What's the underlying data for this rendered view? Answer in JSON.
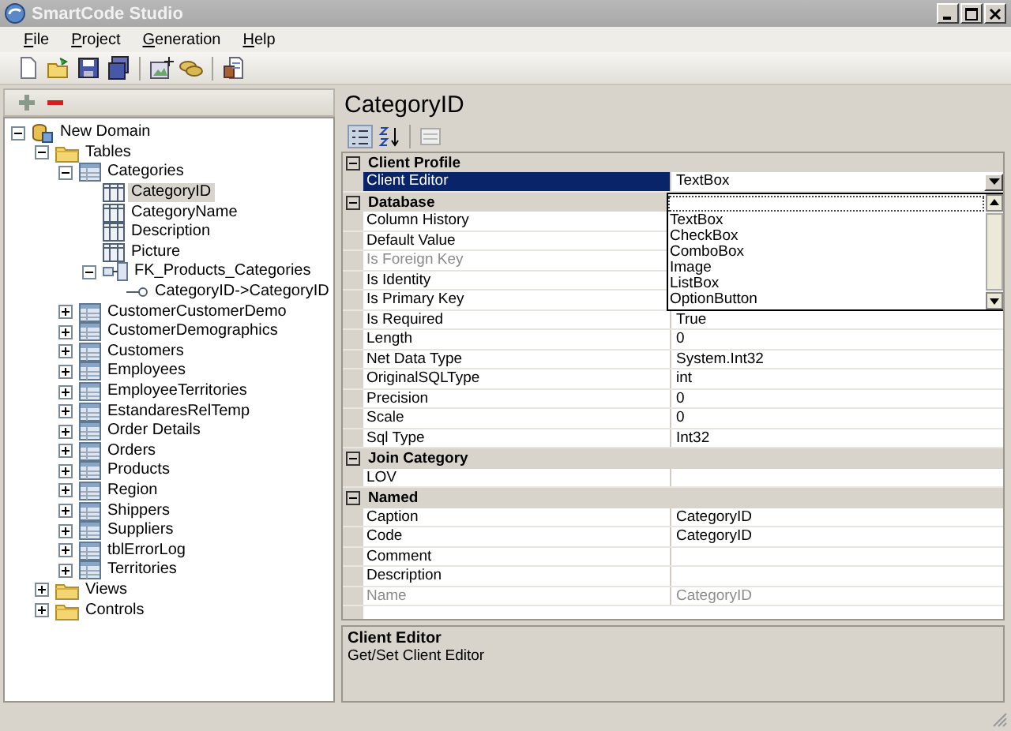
{
  "window": {
    "title": "SmartCode Studio"
  },
  "menu": [
    {
      "label": "File"
    },
    {
      "label": "Project"
    },
    {
      "label": "Generation"
    },
    {
      "label": "Help"
    }
  ],
  "tree": [
    {
      "label": "New Domain",
      "kind": "domain",
      "expanded": true,
      "selected": false,
      "children": [
        {
          "label": "Tables",
          "kind": "folder",
          "expanded": true,
          "selected": false,
          "children": [
            {
              "label": "Categories",
              "kind": "table",
              "expanded": true,
              "selected": false,
              "children": [
                {
                  "label": "CategoryID",
                  "kind": "column",
                  "selected": true
                },
                {
                  "label": "CategoryName",
                  "kind": "column",
                  "selected": false
                },
                {
                  "label": "Description",
                  "kind": "column",
                  "selected": false
                },
                {
                  "label": "Picture",
                  "kind": "column",
                  "selected": false
                },
                {
                  "label": "FK_Products_Categories",
                  "kind": "key",
                  "expanded": true,
                  "selected": false,
                  "children": [
                    {
                      "label": "CategoryID->CategoryID",
                      "kind": "relation",
                      "selected": false
                    }
                  ]
                }
              ]
            },
            {
              "label": "CustomerCustomerDemo",
              "kind": "table",
              "expanded": false,
              "selected": false
            },
            {
              "label": "CustomerDemographics",
              "kind": "table",
              "expanded": false,
              "selected": false
            },
            {
              "label": "Customers",
              "kind": "table",
              "expanded": false,
              "selected": false
            },
            {
              "label": "Employees",
              "kind": "table",
              "expanded": false,
              "selected": false
            },
            {
              "label": "EmployeeTerritories",
              "kind": "table",
              "expanded": false,
              "selected": false
            },
            {
              "label": "EstandaresRelTemp",
              "kind": "table",
              "expanded": false,
              "selected": false
            },
            {
              "label": "Order Details",
              "kind": "table",
              "expanded": false,
              "selected": false
            },
            {
              "label": "Orders",
              "kind": "table",
              "expanded": false,
              "selected": false
            },
            {
              "label": "Products",
              "kind": "table",
              "expanded": false,
              "selected": false
            },
            {
              "label": "Region",
              "kind": "table",
              "expanded": false,
              "selected": false
            },
            {
              "label": "Shippers",
              "kind": "table",
              "expanded": false,
              "selected": false
            },
            {
              "label": "Suppliers",
              "kind": "table",
              "expanded": false,
              "selected": false
            },
            {
              "label": "tblErrorLog",
              "kind": "table",
              "expanded": false,
              "selected": false
            },
            {
              "label": "Territories",
              "kind": "table",
              "expanded": false,
              "selected": false
            }
          ]
        },
        {
          "label": "Views",
          "kind": "folder",
          "expanded": false,
          "selected": false
        },
        {
          "label": "Controls",
          "kind": "folder",
          "expanded": false,
          "selected": false
        }
      ]
    }
  ],
  "properties": {
    "title": "CategoryID",
    "categories": [
      {
        "name": "Client Profile",
        "expanded": true,
        "rows": [
          {
            "name": "Client Editor",
            "value": "TextBox",
            "selected": true,
            "disabled": false
          }
        ]
      },
      {
        "name": "Database",
        "expanded": true,
        "rows": [
          {
            "name": "Column History",
            "selected": false,
            "disabled": false
          },
          {
            "name": "Default Value",
            "selected": false,
            "disabled": false
          },
          {
            "name": "Is Foreign Key",
            "selected": false,
            "disabled": true
          },
          {
            "name": "Is Identity",
            "selected": false,
            "disabled": false
          },
          {
            "name": "Is Primary Key",
            "selected": false,
            "disabled": false
          },
          {
            "name": "Is Required",
            "value": "True",
            "selected": false,
            "disabled": false
          },
          {
            "name": "Length",
            "value": "0",
            "selected": false,
            "disabled": false
          },
          {
            "name": "Net Data Type",
            "value": "System.Int32",
            "selected": false,
            "disabled": false
          },
          {
            "name": "OriginalSQLType",
            "value": "int",
            "selected": false,
            "disabled": false
          },
          {
            "name": "Precision",
            "value": "0",
            "selected": false,
            "disabled": false
          },
          {
            "name": "Scale",
            "value": "0",
            "selected": false,
            "disabled": false
          },
          {
            "name": "Sql Type",
            "value": "Int32",
            "selected": false,
            "disabled": false
          }
        ]
      },
      {
        "name": "Join Category",
        "expanded": true,
        "rows": [
          {
            "name": "LOV",
            "selected": false,
            "disabled": false
          }
        ]
      },
      {
        "name": "Named",
        "expanded": true,
        "rows": [
          {
            "name": "Caption",
            "value": "CategoryID",
            "selected": false,
            "disabled": false
          },
          {
            "name": "Code",
            "value": "CategoryID",
            "selected": false,
            "disabled": false
          },
          {
            "name": "Comment",
            "selected": false,
            "disabled": false
          },
          {
            "name": "Description",
            "selected": false,
            "disabled": false
          },
          {
            "name": "Name",
            "value": "CategoryID",
            "selected": false,
            "disabled": true
          }
        ]
      }
    ]
  },
  "dropdown": {
    "items": [
      "TextBox",
      "CheckBox",
      "ComboBox",
      "Image",
      "ListBox",
      "OptionButton"
    ]
  },
  "description": {
    "title": "Client Editor",
    "text": "Get/Set Client Editor"
  }
}
